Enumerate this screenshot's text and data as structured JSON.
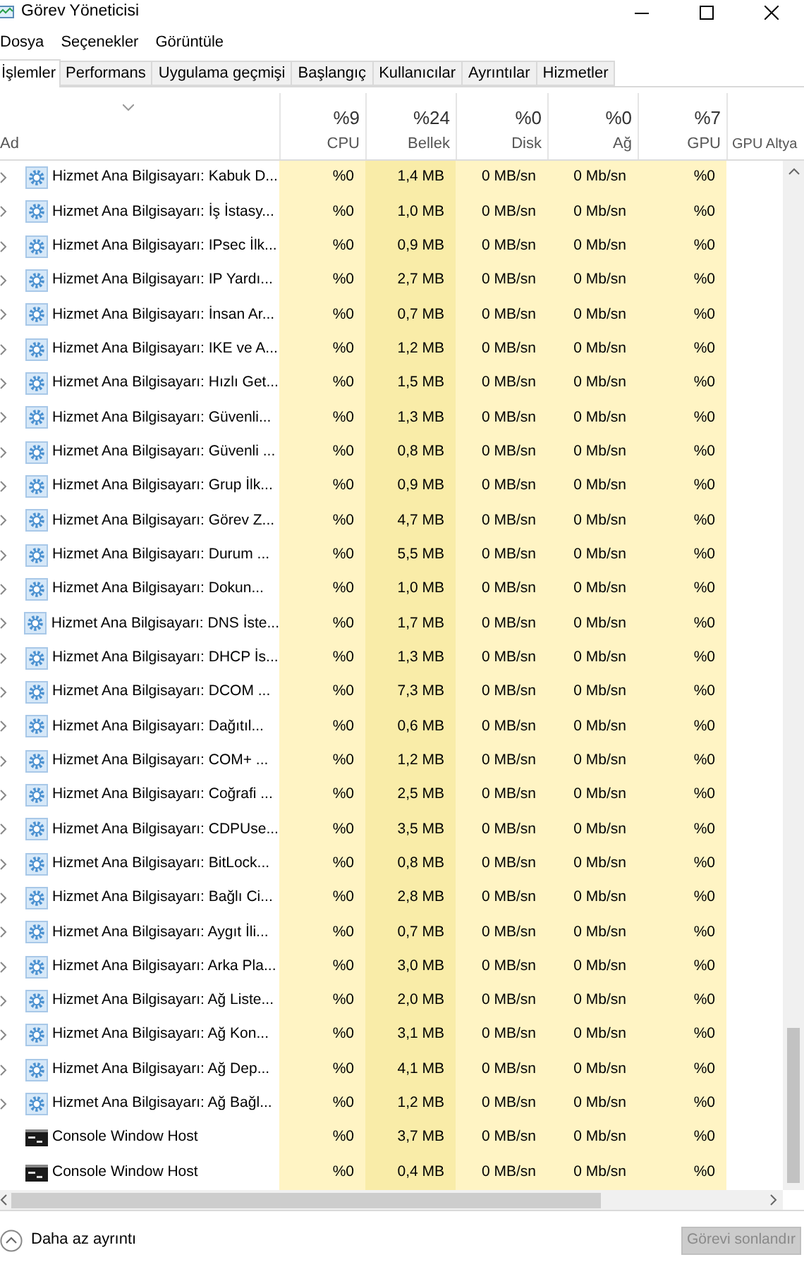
{
  "window": {
    "title": "Görev Yöneticisi"
  },
  "menu": [
    "Dosya",
    "Seçenekler",
    "Görüntüle"
  ],
  "tabs": [
    {
      "label": "İşlemler",
      "selected": true
    },
    {
      "label": "Performans",
      "selected": false
    },
    {
      "label": "Uygulama geçmişi",
      "selected": false
    },
    {
      "label": "Başlangıç",
      "selected": false
    },
    {
      "label": "Kullanıcılar",
      "selected": false
    },
    {
      "label": "Ayrıntılar",
      "selected": false
    },
    {
      "label": "Hizmetler",
      "selected": false
    }
  ],
  "table": {
    "name_column": "Ad",
    "columns": [
      {
        "usage": "%9",
        "label": "CPU",
        "highlight": false
      },
      {
        "usage": "%24",
        "label": "Bellek",
        "highlight": true
      },
      {
        "usage": "%0",
        "label": "Disk",
        "highlight": false
      },
      {
        "usage": "%0",
        "label": "Ağ",
        "highlight": false
      },
      {
        "usage": "%7",
        "label": "GPU",
        "highlight": false
      },
      {
        "label": "GPU Altya"
      }
    ],
    "rows": [
      {
        "kind": "service",
        "name": "Hizmet Ana Bilgisayarı: Kabuk D...",
        "cpu": "%0",
        "memory": "1,4 MB",
        "disk": "0 MB/sn",
        "network": "0 Mb/sn",
        "gpu": "%0"
      },
      {
        "kind": "service",
        "name": "Hizmet Ana Bilgisayarı: İş İstasy...",
        "cpu": "%0",
        "memory": "1,0 MB",
        "disk": "0 MB/sn",
        "network": "0 Mb/sn",
        "gpu": "%0"
      },
      {
        "kind": "service",
        "name": "Hizmet Ana Bilgisayarı: IPsec İlk...",
        "cpu": "%0",
        "memory": "0,9 MB",
        "disk": "0 MB/sn",
        "network": "0 Mb/sn",
        "gpu": "%0"
      },
      {
        "kind": "service",
        "name": "Hizmet Ana Bilgisayarı: IP Yardı...",
        "cpu": "%0",
        "memory": "2,7 MB",
        "disk": "0 MB/sn",
        "network": "0 Mb/sn",
        "gpu": "%0"
      },
      {
        "kind": "service",
        "name": "Hizmet Ana Bilgisayarı: İnsan Ar...",
        "cpu": "%0",
        "memory": "0,7 MB",
        "disk": "0 MB/sn",
        "network": "0 Mb/sn",
        "gpu": "%0"
      },
      {
        "kind": "service",
        "name": "Hizmet Ana Bilgisayarı: IKE ve A...",
        "cpu": "%0",
        "memory": "1,2 MB",
        "disk": "0 MB/sn",
        "network": "0 Mb/sn",
        "gpu": "%0"
      },
      {
        "kind": "service",
        "name": "Hizmet Ana Bilgisayarı: Hızlı Get...",
        "cpu": "%0",
        "memory": "1,5 MB",
        "disk": "0 MB/sn",
        "network": "0 Mb/sn",
        "gpu": "%0"
      },
      {
        "kind": "service",
        "name": "Hizmet Ana Bilgisayarı: Güvenli...",
        "cpu": "%0",
        "memory": "1,3 MB",
        "disk": "0 MB/sn",
        "network": "0 Mb/sn",
        "gpu": "%0"
      },
      {
        "kind": "service",
        "name": "Hizmet Ana Bilgisayarı: Güvenli ...",
        "cpu": "%0",
        "memory": "0,8 MB",
        "disk": "0 MB/sn",
        "network": "0 Mb/sn",
        "gpu": "%0"
      },
      {
        "kind": "service",
        "name": "Hizmet Ana Bilgisayarı: Grup İlk...",
        "cpu": "%0",
        "memory": "0,9 MB",
        "disk": "0 MB/sn",
        "network": "0 Mb/sn",
        "gpu": "%0"
      },
      {
        "kind": "service",
        "name": "Hizmet Ana Bilgisayarı: Görev Z...",
        "cpu": "%0",
        "memory": "4,7 MB",
        "disk": "0 MB/sn",
        "network": "0 Mb/sn",
        "gpu": "%0"
      },
      {
        "kind": "service",
        "name": "Hizmet Ana Bilgisayarı: Durum ...",
        "cpu": "%0",
        "memory": "5,5 MB",
        "disk": "0 MB/sn",
        "network": "0 Mb/sn",
        "gpu": "%0"
      },
      {
        "kind": "service",
        "name": "Hizmet Ana Bilgisayarı: Dokun...",
        "cpu": "%0",
        "memory": "1,0 MB",
        "disk": "0 MB/sn",
        "network": "0 Mb/sn",
        "gpu": "%0"
      },
      {
        "kind": "service",
        "name": "Hizmet Ana Bilgisayarı: DNS İste...",
        "cpu": "%0",
        "memory": "1,7 MB",
        "disk": "0 MB/sn",
        "network": "0 Mb/sn",
        "gpu": "%0"
      },
      {
        "kind": "service",
        "name": "Hizmet Ana Bilgisayarı: DHCP İs...",
        "cpu": "%0",
        "memory": "1,3 MB",
        "disk": "0 MB/sn",
        "network": "0 Mb/sn",
        "gpu": "%0"
      },
      {
        "kind": "service",
        "name": "Hizmet Ana Bilgisayarı: DCOM ...",
        "cpu": "%0",
        "memory": "7,3 MB",
        "disk": "0 MB/sn",
        "network": "0 Mb/sn",
        "gpu": "%0"
      },
      {
        "kind": "service",
        "name": "Hizmet Ana Bilgisayarı: Dağıtıl...",
        "cpu": "%0",
        "memory": "0,6 MB",
        "disk": "0 MB/sn",
        "network": "0 Mb/sn",
        "gpu": "%0"
      },
      {
        "kind": "service",
        "name": "Hizmet Ana Bilgisayarı: COM+ ...",
        "cpu": "%0",
        "memory": "1,2 MB",
        "disk": "0 MB/sn",
        "network": "0 Mb/sn",
        "gpu": "%0"
      },
      {
        "kind": "service",
        "name": "Hizmet Ana Bilgisayarı: Coğrafi ...",
        "cpu": "%0",
        "memory": "2,5 MB",
        "disk": "0 MB/sn",
        "network": "0 Mb/sn",
        "gpu": "%0"
      },
      {
        "kind": "service",
        "name": "Hizmet Ana Bilgisayarı: CDPUse...",
        "cpu": "%0",
        "memory": "3,5 MB",
        "disk": "0 MB/sn",
        "network": "0 Mb/sn",
        "gpu": "%0"
      },
      {
        "kind": "service",
        "name": "Hizmet Ana Bilgisayarı: BitLock...",
        "cpu": "%0",
        "memory": "0,8 MB",
        "disk": "0 MB/sn",
        "network": "0 Mb/sn",
        "gpu": "%0"
      },
      {
        "kind": "service",
        "name": "Hizmet Ana Bilgisayarı: Bağlı Ci...",
        "cpu": "%0",
        "memory": "2,8 MB",
        "disk": "0 MB/sn",
        "network": "0 Mb/sn",
        "gpu": "%0"
      },
      {
        "kind": "service",
        "name": "Hizmet Ana Bilgisayarı: Aygıt İli...",
        "cpu": "%0",
        "memory": "0,7 MB",
        "disk": "0 MB/sn",
        "network": "0 Mb/sn",
        "gpu": "%0"
      },
      {
        "kind": "service",
        "name": "Hizmet Ana Bilgisayarı: Arka Pla...",
        "cpu": "%0",
        "memory": "3,0 MB",
        "disk": "0 MB/sn",
        "network": "0 Mb/sn",
        "gpu": "%0"
      },
      {
        "kind": "service",
        "name": "Hizmet Ana Bilgisayarı: Ağ Liste...",
        "cpu": "%0",
        "memory": "2,0 MB",
        "disk": "0 MB/sn",
        "network": "0 Mb/sn",
        "gpu": "%0"
      },
      {
        "kind": "service",
        "name": "Hizmet Ana Bilgisayarı: Ağ Kon...",
        "cpu": "%0",
        "memory": "3,1 MB",
        "disk": "0 MB/sn",
        "network": "0 Mb/sn",
        "gpu": "%0"
      },
      {
        "kind": "service",
        "name": "Hizmet Ana Bilgisayarı: Ağ Dep...",
        "cpu": "%0",
        "memory": "4,1 MB",
        "disk": "0 MB/sn",
        "network": "0 Mb/sn",
        "gpu": "%0"
      },
      {
        "kind": "service",
        "name": "Hizmet Ana Bilgisayarı: Ağ Bağl...",
        "cpu": "%0",
        "memory": "1,2 MB",
        "disk": "0 MB/sn",
        "network": "0 Mb/sn",
        "gpu": "%0"
      },
      {
        "kind": "console",
        "name": "Console Window Host",
        "cpu": "%0",
        "memory": "3,7 MB",
        "disk": "0 MB/sn",
        "network": "0 Mb/sn",
        "gpu": "%0"
      },
      {
        "kind": "console",
        "name": "Console Window Host",
        "cpu": "%0",
        "memory": "0,4 MB",
        "disk": "0 MB/sn",
        "network": "0 Mb/sn",
        "gpu": "%0"
      }
    ]
  },
  "footer": {
    "toggle": "Daha az ayrıntı",
    "end_task": {
      "label": "Görevi sonlandır",
      "disabled": true
    }
  }
}
